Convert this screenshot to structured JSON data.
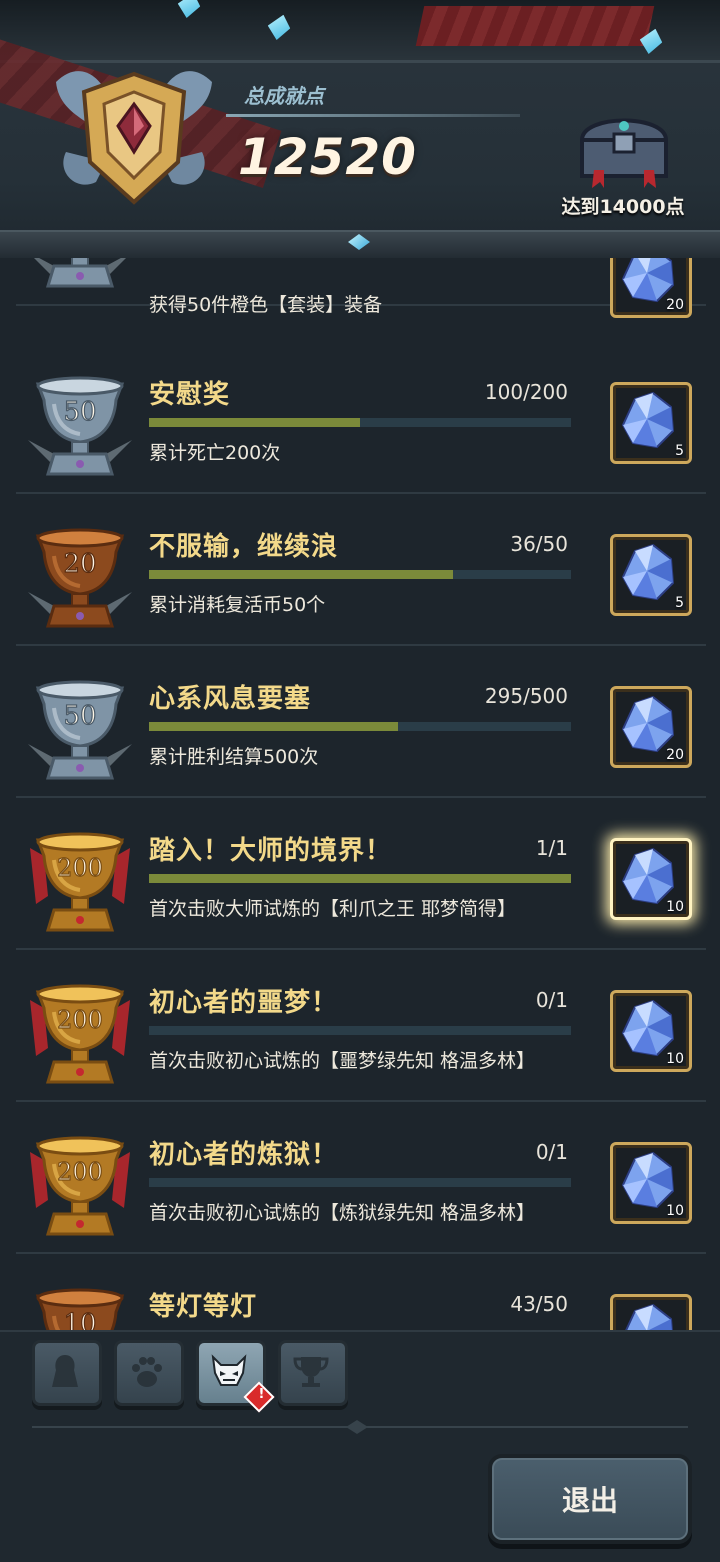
{
  "header": {
    "total_label": "总成就点",
    "total_value": "12520",
    "reward_goal": "达到14000点"
  },
  "achievements": [
    {
      "title": "",
      "progress": "",
      "fraction": 0,
      "desc": "获得50件橙色【套装】装备",
      "trophy": "silver",
      "trophy_points": "",
      "reward_count": "20",
      "glow": false
    },
    {
      "title": "安慰奖",
      "progress": "100/200",
      "fraction": 0.5,
      "desc": "累计死亡200次",
      "trophy": "silver",
      "trophy_points": "50",
      "reward_count": "5",
      "glow": false
    },
    {
      "title": "不服输，继续浪",
      "progress": "36/50",
      "fraction": 0.72,
      "desc": "累计消耗复活币50个",
      "trophy": "bronze",
      "trophy_points": "20",
      "reward_count": "5",
      "glow": false
    },
    {
      "title": "心系风息要塞",
      "progress": "295/500",
      "fraction": 0.59,
      "desc": "累计胜利结算500次",
      "trophy": "silver",
      "trophy_points": "50",
      "reward_count": "20",
      "glow": false
    },
    {
      "title": "踏入！大师的境界！",
      "progress": "1/1",
      "fraction": 1.0,
      "desc": "首次击败大师试炼的【利爪之王 耶梦简得】",
      "trophy": "gold",
      "trophy_points": "200",
      "reward_count": "10",
      "glow": true
    },
    {
      "title": "初心者的噩梦！",
      "progress": "0/1",
      "fraction": 0,
      "desc": "首次击败初心试炼的【噩梦绿先知 格温多林】",
      "trophy": "gold",
      "trophy_points": "200",
      "reward_count": "10",
      "glow": false
    },
    {
      "title": "初心者的炼狱！",
      "progress": "0/1",
      "fraction": 0,
      "desc": "首次击败初心试炼的【炼狱绿先知 格温多林】",
      "trophy": "gold",
      "trophy_points": "200",
      "reward_count": "10",
      "glow": false
    },
    {
      "title": "等灯等灯",
      "progress": "43/50",
      "fraction": 0.86,
      "desc": "",
      "trophy": "bronze",
      "trophy_points": "10",
      "reward_count": "",
      "glow": false
    }
  ],
  "tabs": [
    {
      "icon": "character-silhouette-icon",
      "active": false
    },
    {
      "icon": "paw-icon",
      "active": false
    },
    {
      "icon": "demon-mask-icon",
      "active": true,
      "alert": "!"
    },
    {
      "icon": "trophy-icon",
      "active": false
    }
  ],
  "footer": {
    "exit_label": "退出"
  },
  "colors": {
    "title": "#f3d98a",
    "progress_fill": "#7b8a3a",
    "progress_track": "#2a3d48",
    "background": "#1d252c"
  }
}
